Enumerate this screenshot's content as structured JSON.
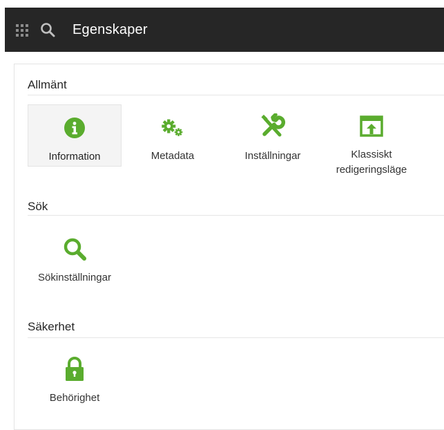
{
  "header": {
    "title": "Egenskaper",
    "icons": [
      "app-launcher-icon",
      "search-icon"
    ]
  },
  "colors": {
    "topbar": "#262626",
    "accent_green": "#5aac2e",
    "text": "#333333"
  },
  "sections": [
    {
      "title": "Allmänt",
      "items": [
        {
          "label": "Information",
          "icon": "info-icon",
          "selected": true
        },
        {
          "label": "Metadata",
          "icon": "gears-icon",
          "selected": false
        },
        {
          "label": "Inställningar",
          "icon": "tools-icon",
          "selected": false
        },
        {
          "label": "Klassiskt\nredigeringsläge",
          "icon": "classic-edit-icon",
          "selected": false
        }
      ]
    },
    {
      "title": "Sök",
      "items": [
        {
          "label": "Sökinställningar",
          "icon": "search-settings-icon",
          "selected": false
        }
      ]
    },
    {
      "title": "Säkerhet",
      "items": [
        {
          "label": "Behörighet",
          "icon": "lock-icon",
          "selected": false
        }
      ]
    }
  ]
}
